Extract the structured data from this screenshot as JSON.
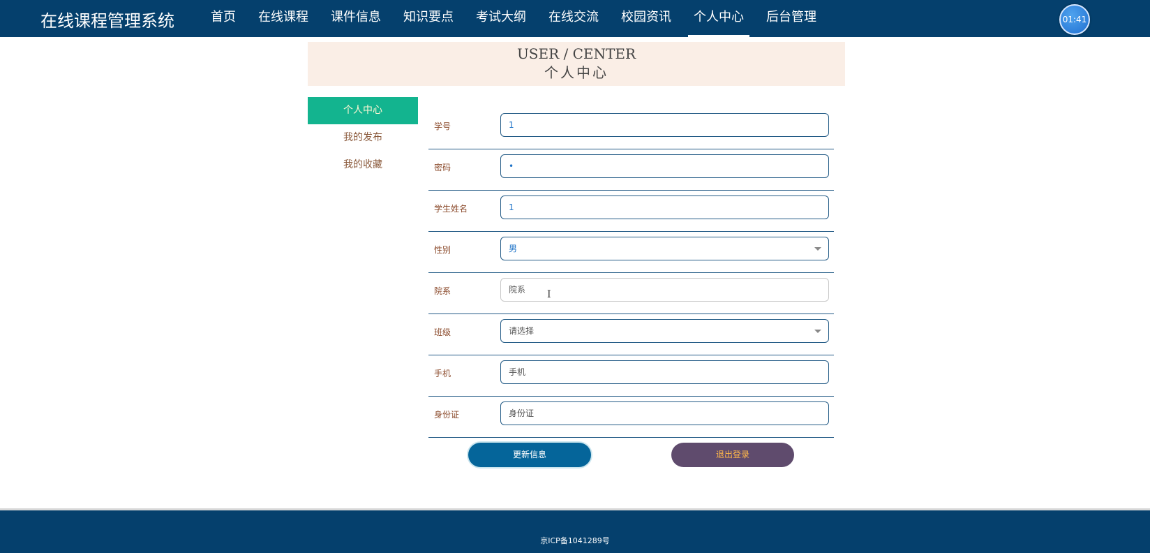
{
  "header": {
    "brand": "在线课程管理系统",
    "nav": [
      {
        "label": "首页",
        "name": "nav-home",
        "active": false
      },
      {
        "label": "在线课程",
        "name": "nav-online-course",
        "active": false
      },
      {
        "label": "课件信息",
        "name": "nav-courseware",
        "active": false
      },
      {
        "label": "知识要点",
        "name": "nav-knowledge",
        "active": false
      },
      {
        "label": "考试大纲",
        "name": "nav-exam-outline",
        "active": false
      },
      {
        "label": "在线交流",
        "name": "nav-forum",
        "active": false
      },
      {
        "label": "校园资讯",
        "name": "nav-campus-news",
        "active": false
      },
      {
        "label": "个人中心",
        "name": "nav-user-center",
        "active": true
      },
      {
        "label": "后台管理",
        "name": "nav-admin",
        "active": false
      }
    ],
    "clock": "01:41"
  },
  "banner": {
    "title_en": "USER / CENTER",
    "title_zh": "个人中心"
  },
  "sidebar": {
    "items": [
      {
        "label": "个人中心",
        "name": "sidebar-item-user-center",
        "active": true
      },
      {
        "label": "我的发布",
        "name": "sidebar-item-my-posts",
        "active": false
      },
      {
        "label": "我的收藏",
        "name": "sidebar-item-my-favorites",
        "active": false
      }
    ]
  },
  "form": {
    "student_no": {
      "label": "学号",
      "value": "1"
    },
    "password": {
      "label": "密码",
      "value": "•"
    },
    "student_name": {
      "label": "学生姓名",
      "value": "1"
    },
    "gender": {
      "label": "性别",
      "value": "男"
    },
    "department": {
      "label": "院系",
      "placeholder": "院系"
    },
    "class": {
      "label": "班级",
      "value": "请选择"
    },
    "phone": {
      "label": "手机",
      "placeholder": "手机"
    },
    "id_card": {
      "label": "身份证",
      "placeholder": "身份证"
    }
  },
  "buttons": {
    "update": "更新信息",
    "logout": "退出登录"
  },
  "footer": {
    "icp": "京ICP备1041289号"
  },
  "colors": {
    "header_bg": "#05406d",
    "sidebar_active": "#13b48f",
    "banner_bg": "#faeee6",
    "update_button": "#05659a",
    "logout_button": "#5f4b6d"
  }
}
